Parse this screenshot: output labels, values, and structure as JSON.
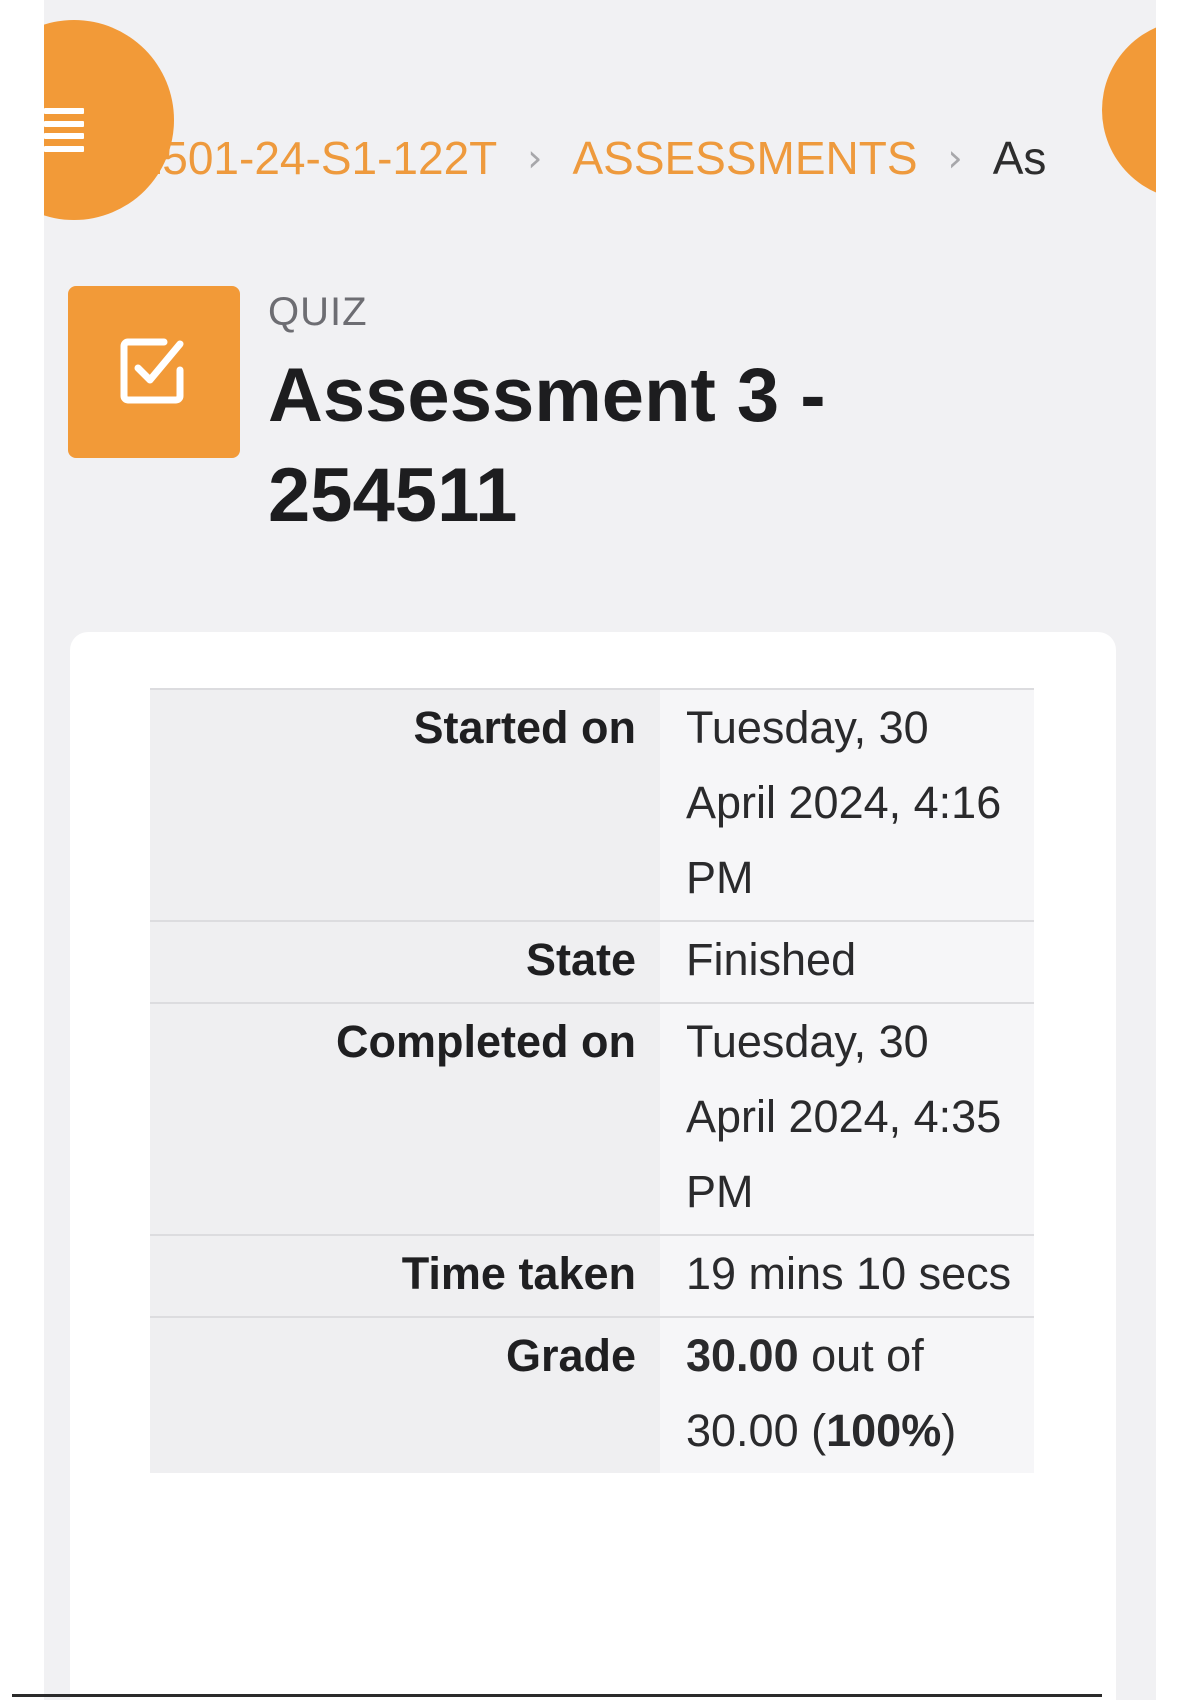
{
  "breadcrumb": {
    "items": [
      {
        "label": "P1501-24-S1-122T"
      },
      {
        "label": "ASSESSMENTS"
      },
      {
        "label": "As"
      }
    ],
    "separator": "›"
  },
  "header": {
    "type_label": "QUIZ",
    "title": "Assessment 3 - 254511",
    "icon": "checkbox-edit-icon"
  },
  "summary": {
    "rows": [
      {
        "label": "Started on",
        "value": "Tuesday, 30 April 2024, 4:16 PM"
      },
      {
        "label": "State",
        "value": "Finished"
      },
      {
        "label": "Completed on",
        "value": "Tuesday, 30 April 2024, 4:35 PM"
      },
      {
        "label": "Time taken",
        "value": "19 mins 10 secs"
      },
      {
        "label": "Grade",
        "value_bold": "30.00",
        "value_mid": " out of 30.00 (",
        "value_pct": "100%",
        "value_end": ")"
      }
    ]
  },
  "colors": {
    "accent": "#f29a38",
    "link": "#ee9a3d",
    "background": "#f1f1f3"
  },
  "icons": {
    "menu": "hamburger-menu-icon",
    "chevron": "chevron-right-icon"
  }
}
